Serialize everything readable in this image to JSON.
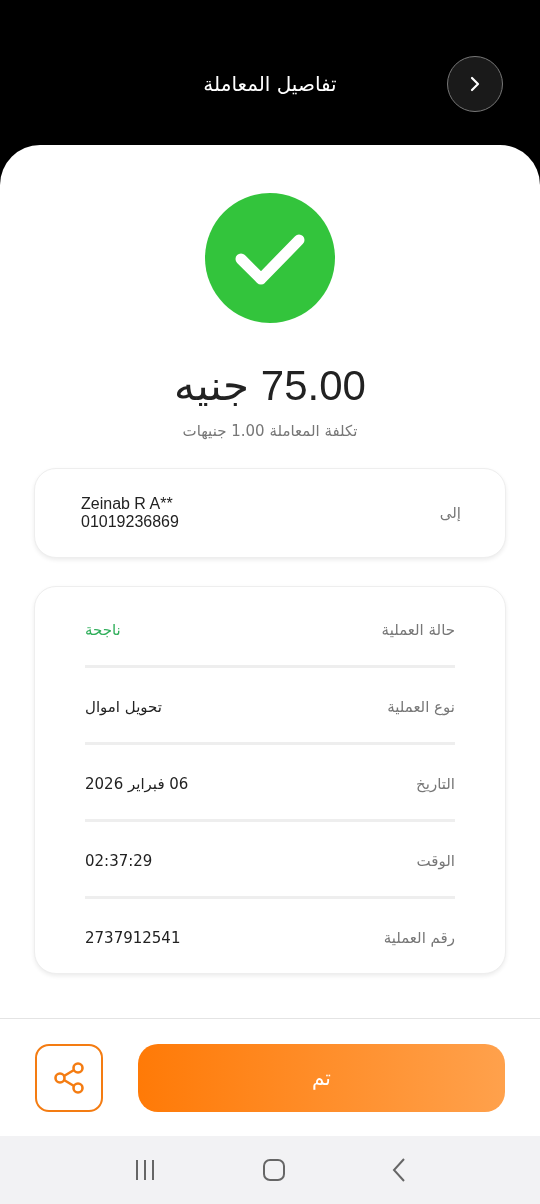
{
  "header": {
    "title": "تفاصيل المعاملة"
  },
  "amount": "75.00 جنيه",
  "fee": "تكلفة المعاملة 1.00 جنيهات",
  "recipient": {
    "label": "إلى",
    "name": "Zeinab R A**",
    "phone": "01019236869"
  },
  "details": [
    {
      "label": "حالة العملية",
      "value": "ناجحة",
      "kind": "success"
    },
    {
      "label": "نوع العملية",
      "value": "تحويل اموال",
      "kind": "plain"
    },
    {
      "label": "التاريخ",
      "value": "06 فبراير 2026",
      "kind": "plain"
    },
    {
      "label": "الوقت",
      "value": "02:37:29",
      "kind": "plain"
    },
    {
      "label": "رقم العملية",
      "value": "2737912541",
      "kind": "plain"
    }
  ],
  "done_button": "تم"
}
